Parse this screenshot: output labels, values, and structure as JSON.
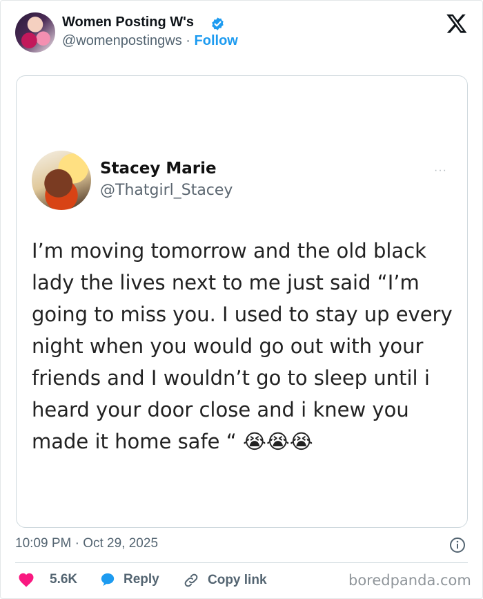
{
  "author": {
    "name": "Women Posting W's",
    "handle": "@womenpostingws",
    "separator": "·",
    "follow_label": "Follow"
  },
  "embedded_post": {
    "name": "Stacey Marie",
    "handle": "@Thatgirl_Stacey",
    "more_label": "···",
    "text": "I’m moving tomorrow and the old black lady the lives next to me just said “I’m going to miss you. I used to stay up every night when you would go out with your friends and I wouldn’t go to sleep until i heard your door close and i knew you made it home safe “",
    "emojis": "😭😭😭"
  },
  "timestamp": "10:09 PM · Oct 29, 2025",
  "actions": {
    "likes_count": "5.6K",
    "reply_label": "Reply",
    "copy_link_label": "Copy link"
  },
  "watermark": "boredpanda.com",
  "colors": {
    "accent": "#1d9bf0",
    "heart": "#f91880",
    "muted": "#536471"
  },
  "icons": [
    "x-logo-icon",
    "verified-badge-icon",
    "info-icon",
    "heart-icon",
    "reply-bubble-icon",
    "link-icon",
    "more-icon"
  ]
}
